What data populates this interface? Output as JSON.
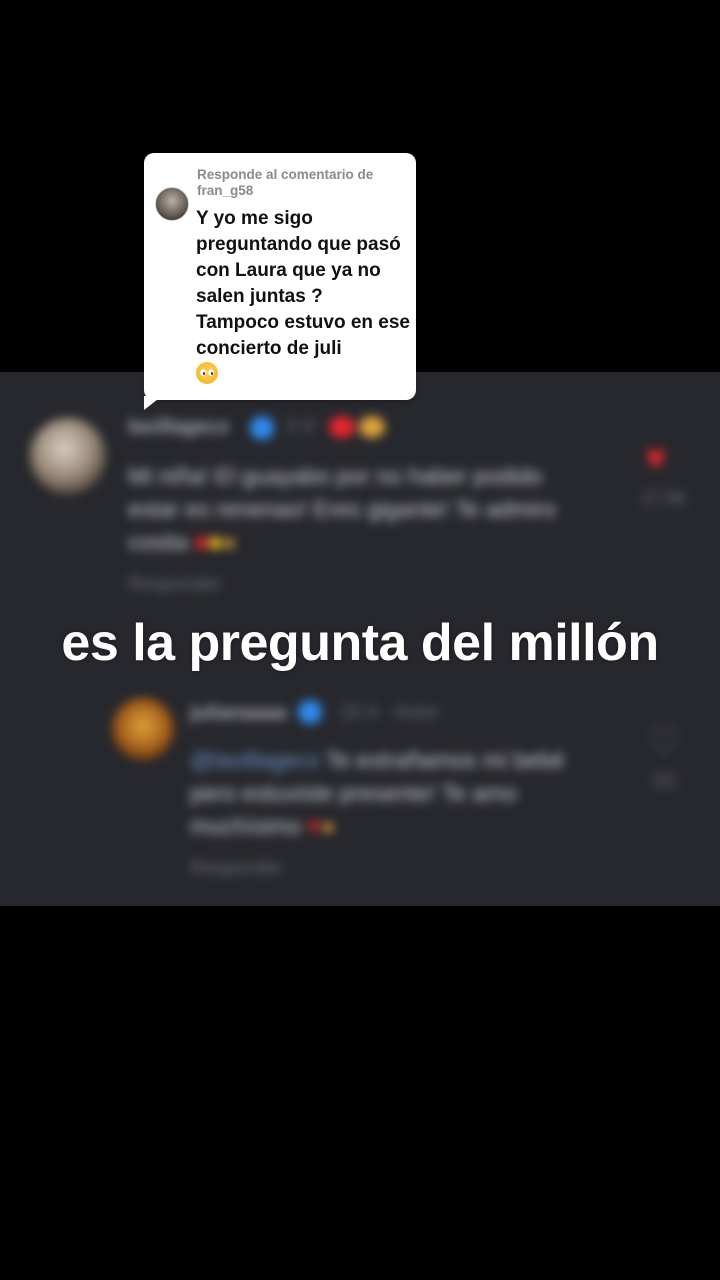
{
  "sticker": {
    "header": "Responde al comentario de fran_g58",
    "body": "Y yo me sigo preguntando que pasó con Laura que ya no salen juntas ? Tampoco estuvo en ese concierto de juli"
  },
  "caption": "es la pregunta del millón",
  "colors": {
    "background": "#000000",
    "panel": "#27282d",
    "sticker": "#ffffff",
    "caption": "#ffffff",
    "like_red": "#e8262d",
    "verified_blue": "#2f8cf0"
  },
  "icons": {
    "sticker_emoji": "pleading-face-icon",
    "comment_like": "heart-icon",
    "reply_like": "heart-outline-icon"
  }
}
